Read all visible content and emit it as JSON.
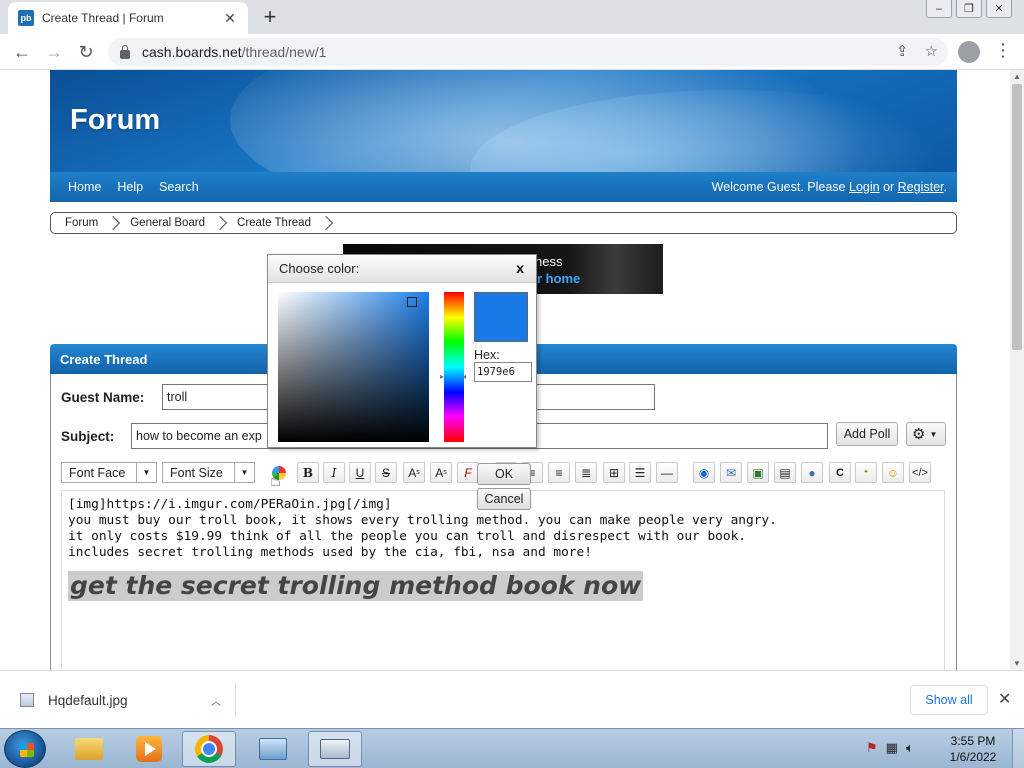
{
  "browser": {
    "tab_title": "Create Thread | Forum",
    "favicon_text": "pb",
    "url_host": "cash.boards.net",
    "url_path": "/thread/new/1"
  },
  "forum": {
    "banner_title": "Forum",
    "nav": [
      "Home",
      "Help",
      "Search"
    ],
    "welcome_prefix": "Welcome Guest. Please ",
    "login": "Login",
    "or": " or ",
    "register": "Register",
    "period": ".",
    "breadcrumb": [
      "Forum",
      "General Board",
      "Create Thread"
    ]
  },
  "ad": {
    "line1": "ness",
    "line2": "ur home"
  },
  "form": {
    "panel_title": "Create Thread",
    "guest_label": "Guest Name:",
    "guest_value": "troll",
    "subject_label": "Subject:",
    "subject_value": "how to become an exp",
    "add_poll": "Add Poll",
    "font_face": "Font Face",
    "font_size": "Font Size"
  },
  "editor": {
    "line1": "[img]https://i.imgur.com/PERaOin.jpg[/img]",
    "line2": "you must buy our troll book, it shows every trolling method. you can make people very angry.",
    "line3": "it only costs $19.99 think of all the people you can troll and disrespect with our book.",
    "line4": "includes secret trolling methods used by the cia, fbi, nsa and more!",
    "big_line": "get the secret trolling method book now"
  },
  "color_picker": {
    "title": "Choose color:",
    "close": "x",
    "hex_label": "Hex:",
    "hex_value": "1979e6",
    "swatch_color": "#1979e6",
    "ok": "OK",
    "cancel": "Cancel"
  },
  "downloads": {
    "file": "Hqdefault.jpg",
    "show_all": "Show all"
  },
  "taskbar": {
    "time": "3:55 PM",
    "date": "1/6/2022"
  }
}
